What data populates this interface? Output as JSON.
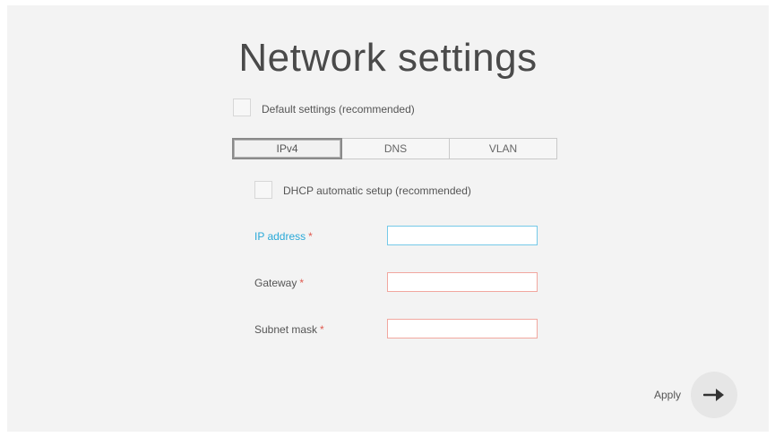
{
  "page": {
    "title": "Network settings"
  },
  "default_settings": {
    "label": "Default settings (recommended)",
    "checked": false
  },
  "tabs": [
    {
      "label": "IPv4",
      "active": true
    },
    {
      "label": "DNS",
      "active": false
    },
    {
      "label": "VLAN",
      "active": false
    }
  ],
  "dhcp": {
    "label": "DHCP automatic setup (recommended)",
    "checked": false
  },
  "fields": {
    "ip_address": {
      "label": "IP address",
      "required_mark": "*",
      "value": ""
    },
    "gateway": {
      "label": "Gateway",
      "required_mark": "*",
      "value": ""
    },
    "subnet_mask": {
      "label": "Subnet mask",
      "required_mark": "*",
      "value": ""
    }
  },
  "apply": {
    "label": "Apply",
    "icon": "arrow-right-icon"
  },
  "colors": {
    "background": "#f3f3f3",
    "focus_blue": "#2aa9d8",
    "required_red": "#e05a4f",
    "invalid_border": "#f1a79f"
  }
}
